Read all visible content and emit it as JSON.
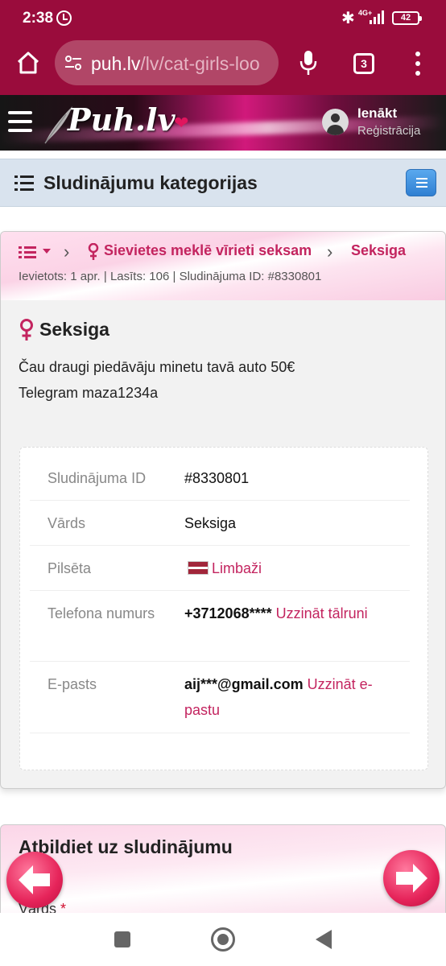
{
  "status_bar": {
    "time": "2:38",
    "network": "4G+",
    "battery": "42"
  },
  "browser": {
    "url_domain": "puh.lv",
    "url_path": "/lv/cat-girls-loo",
    "tab_count": "3"
  },
  "site_header": {
    "logo": "Puh.lv",
    "login": "Ienākt",
    "register": "Reģistrācija"
  },
  "categories": {
    "title": "Sludinājumu kategorijas"
  },
  "breadcrumb": {
    "category": "Sievietes meklē vīrieti seksam",
    "current": "Seksiga"
  },
  "meta": "Ievietots: 1 apr. | Lasīts: 106 | Sludinājuma ID: #8330801",
  "ad": {
    "title": "Seksiga",
    "text_line1": "Čau draugi piedāvāju minetu tavā auto 50€",
    "text_line2": "Telegram maza1234a"
  },
  "details": {
    "id_label": "Sludinājuma ID",
    "id_value": "#8330801",
    "name_label": "Vārds",
    "name_value": "Seksiga",
    "city_label": "Pilsēta",
    "city_value": "Limbaži",
    "phone_label": "Telefona numurs",
    "phone_value": "+3712068****",
    "phone_link": "Uzzināt tālruni",
    "email_label": "E-pasts",
    "email_value": "aij***@gmail.com",
    "email_link": "Uzzināt e-pastu"
  },
  "reply": {
    "title": "Atbildiet uz sludinājumu",
    "name_label": "Vārds",
    "required_mark": "*"
  },
  "colors": {
    "brand": "#9a0c3c",
    "accent": "#c3245f",
    "category_bar": "#d9e3ee"
  }
}
